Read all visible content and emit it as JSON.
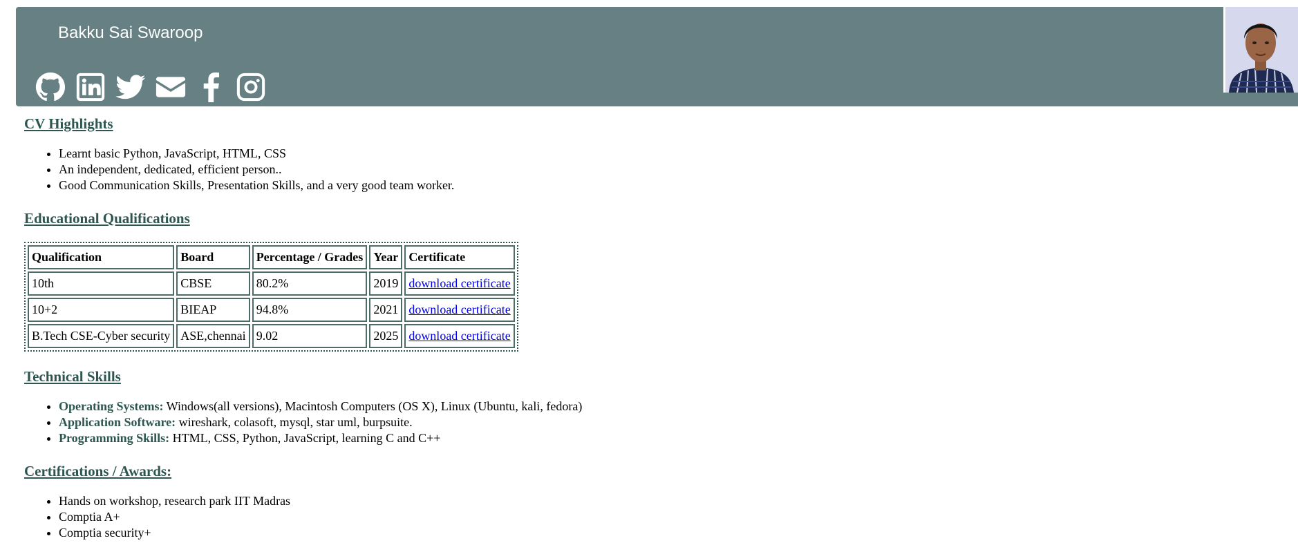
{
  "header": {
    "name": "Bakku Sai Swaroop",
    "background_color": "#678083",
    "social_icons": [
      "github-icon",
      "linkedin-icon",
      "twitter-icon",
      "email-icon",
      "facebook-icon",
      "instagram-icon"
    ],
    "photo": "profile-photo"
  },
  "accent_color": "#2d5650",
  "sections": {
    "highlights": {
      "title": "CV Highlights",
      "items": [
        "Learnt basic Python, JavaScript, HTML, CSS",
        "An independent, dedicated, efficient person..",
        "Good Communication Skills, Presentation Skills, and a very good team worker."
      ]
    },
    "education": {
      "title": "Educational Qualifications",
      "columns": [
        "Qualification",
        "Board",
        "Percentage / Grades",
        "Year",
        "Certificate"
      ],
      "rows": [
        [
          "10th",
          "CBSE",
          "80.2%",
          "2019",
          "download certificate"
        ],
        [
          "10+2",
          "BIEAP",
          "94.8%",
          "2021",
          "download certificate"
        ],
        [
          "B.Tech CSE-Cyber security",
          "ASE,chennai",
          "9.02",
          "2025",
          "download certificate"
        ]
      ]
    },
    "skills": {
      "title": "Technical Skills",
      "items": [
        {
          "label": "Operating Systems:",
          "value": " Windows(all versions), Macintosh Computers (OS X), Linux (Ubuntu, kali, fedora)"
        },
        {
          "label": "Application Software:",
          "value": " wireshark, colasoft, mysql, star uml, burpsuite."
        },
        {
          "label": "Programming Skills:",
          "value": " HTML, CSS, Python, JavaScript, learning C and C++"
        }
      ]
    },
    "certifications": {
      "title": "Certifications / Awards:",
      "items": [
        "Hands on workshop, research park IIT Madras",
        "Comptia A+",
        "Comptia security+"
      ]
    }
  }
}
